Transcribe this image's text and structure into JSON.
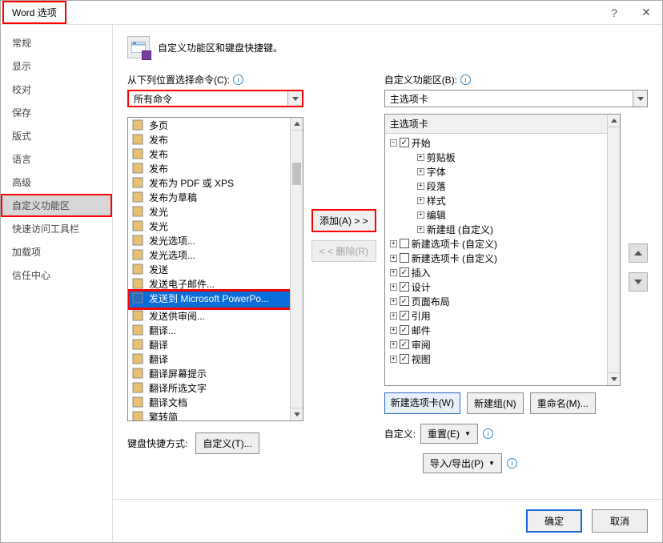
{
  "title": "Word 选项",
  "sidebar": [
    "常规",
    "显示",
    "校对",
    "保存",
    "版式",
    "语言",
    "高级",
    "自定义功能区",
    "快速访问工具栏",
    "加载项",
    "信任中心"
  ],
  "sidebar_selected": 7,
  "header_desc": "自定义功能区和键盘快捷键。",
  "left": {
    "label": "从下列位置选择命令(C):",
    "dd": "所有命令",
    "items": [
      {
        "t": "多页"
      },
      {
        "t": "发布",
        "h": true
      },
      {
        "t": "发布",
        "h": true
      },
      {
        "t": "发布",
        "h": true
      },
      {
        "t": "发布为 PDF 或 XPS"
      },
      {
        "t": "发布为草稿"
      },
      {
        "t": "发光",
        "h": true
      },
      {
        "t": "发光",
        "h": true
      },
      {
        "t": "发光选项..."
      },
      {
        "t": "发光选项..."
      },
      {
        "t": "发送"
      },
      {
        "t": "发送电子邮件..."
      },
      {
        "t": "发送到 Microsoft PowerPo...",
        "sel": true
      },
      {
        "t": "发送供审阅..."
      },
      {
        "t": "翻译..."
      },
      {
        "t": "翻译",
        "h": true
      },
      {
        "t": "翻译",
        "h": true
      },
      {
        "t": "翻译屏幕提示",
        "h": true
      },
      {
        "t": "翻译所选文字"
      },
      {
        "t": "翻译文档"
      },
      {
        "t": "繁转简"
      }
    ]
  },
  "mid": {
    "add": "添加(A) > >",
    "remove": "< < 删除(R)"
  },
  "right": {
    "label": "自定义功能区(B):",
    "dd": "主选项卡",
    "tree_hdr": "主选项卡",
    "tree": {
      "start": "开始",
      "start_children": [
        "剪贴板",
        "字体",
        "段落",
        "样式",
        "编辑",
        "新建组 (自定义)"
      ],
      "tabs": [
        {
          "t": "新建选项卡 (自定义)",
          "chk": false
        },
        {
          "t": "新建选项卡 (自定义)",
          "chk": false
        },
        {
          "t": "插入",
          "chk": true
        },
        {
          "t": "设计",
          "chk": true
        },
        {
          "t": "页面布局",
          "chk": true
        },
        {
          "t": "引用",
          "chk": true
        },
        {
          "t": "邮件",
          "chk": true
        },
        {
          "t": "审阅",
          "chk": true
        },
        {
          "t": "视图",
          "chk": true
        }
      ]
    },
    "btns": {
      "newtab": "新建选项卡(W)",
      "newgrp": "新建组(N)",
      "rename": "重命名(M)..."
    },
    "custom_lbl": "自定义:",
    "reset": "重置(E)",
    "impexp": "导入/导出(P)"
  },
  "keyboard": {
    "label": "键盘快捷方式:",
    "btn": "自定义(T)..."
  },
  "footer": {
    "ok": "确定",
    "cancel": "取消"
  }
}
